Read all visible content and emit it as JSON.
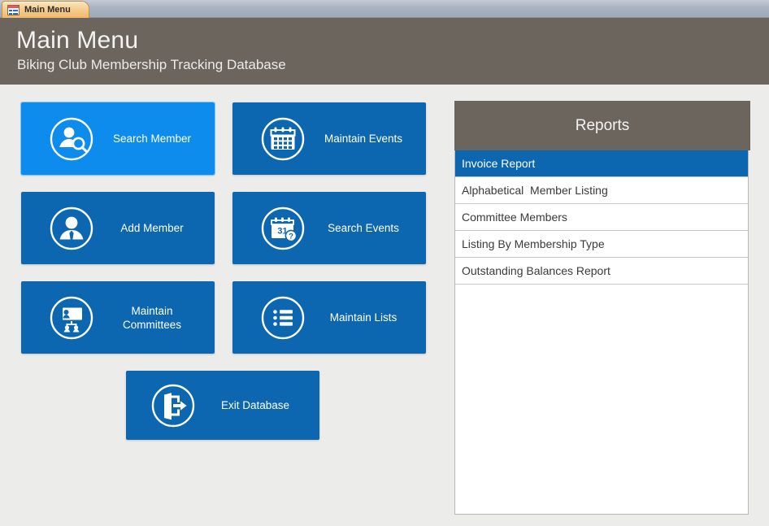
{
  "window": {
    "tab": {
      "label": "Main Menu",
      "icon": "access-form-icon"
    }
  },
  "header": {
    "title": "Main Menu",
    "subtitle": "Biking Club Membership Tracking Database"
  },
  "colors": {
    "accent_blue": "#0C67B0",
    "accent_blue_focused": "#0D8CEE",
    "header_gray": "#6B655E",
    "page_background": "#ECECEA",
    "tabstrip": "#AAB4C0",
    "tab_orange": "#F6CE92"
  },
  "buttons": [
    {
      "id": "search-member",
      "label": "Search Member",
      "icon": "person-search-icon",
      "focused": true
    },
    {
      "id": "maintain-events",
      "label": "Maintain Events",
      "icon": "calendar-icon",
      "focused": false
    },
    {
      "id": "add-member",
      "label": "Add Member",
      "icon": "person-add-icon",
      "focused": false
    },
    {
      "id": "search-events",
      "label": "Search Events",
      "icon": "calendar-search-icon",
      "focused": false
    },
    {
      "id": "maintain-committees",
      "label": "Maintain\nCommittees",
      "icon": "org-chart-icon",
      "focused": false
    },
    {
      "id": "maintain-lists",
      "label": "Maintain Lists",
      "icon": "bullet-list-icon",
      "focused": false
    },
    {
      "id": "exit-database",
      "label": "Exit Database",
      "icon": "exit-door-icon",
      "focused": false
    }
  ],
  "reports": {
    "title": "Reports",
    "selected_index": 0,
    "items": [
      "Invoice Report",
      "Alphabetical  Member Listing",
      "Committee Members",
      "Listing By Membership Type",
      "Outstanding Balances Report"
    ]
  },
  "icon_glyphs": {
    "calendar_day_number": "31"
  }
}
